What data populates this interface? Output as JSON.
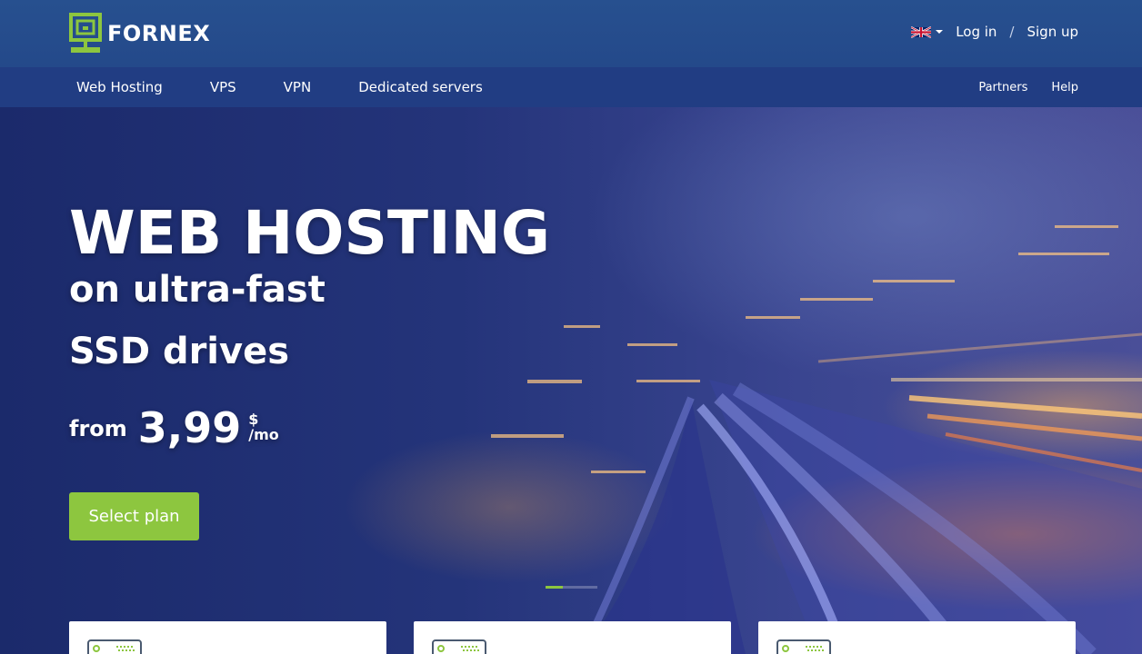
{
  "brand": {
    "name": "FORNEX",
    "green": "#8dc63f",
    "blue": "#27508f"
  },
  "topbar": {
    "language_icon": "uk-flag-icon",
    "login_label": "Log in",
    "separator": "/",
    "signup_label": "Sign up"
  },
  "nav": {
    "items": [
      {
        "label": "Web Hosting"
      },
      {
        "label": "VPS"
      },
      {
        "label": "VPN"
      },
      {
        "label": "Dedicated servers"
      }
    ],
    "right_items": [
      {
        "label": "Partners"
      },
      {
        "label": "Help"
      }
    ]
  },
  "hero": {
    "title": "WEB HOSTING",
    "subtitle_line1": "on ultra-fast",
    "subtitle_line2": "SSD drives",
    "price_prefix": "from",
    "price_amount": "3,99",
    "price_currency": "$",
    "price_period": "/mo",
    "cta_label": "Select plan",
    "slider": {
      "count": 3,
      "active_index": 0
    }
  },
  "cards": [
    {
      "icon": "server-icon"
    },
    {
      "icon": "server-icon"
    },
    {
      "icon": "server-icon"
    }
  ]
}
